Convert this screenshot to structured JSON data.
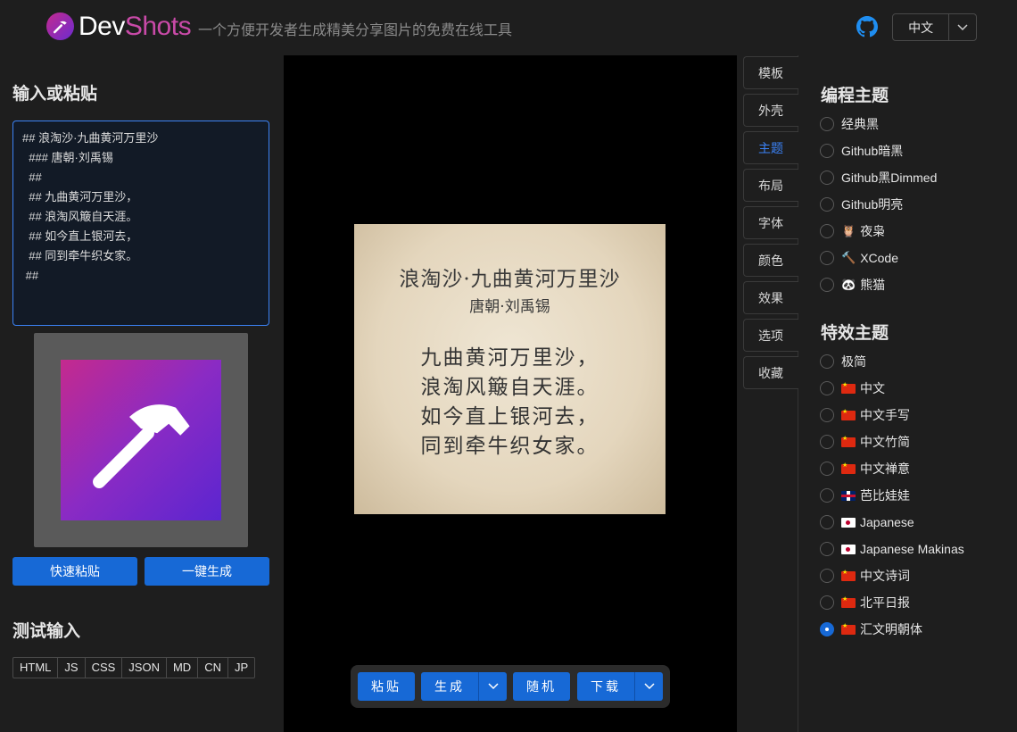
{
  "header": {
    "brand_dev": "Dev",
    "brand_shots": "Shots",
    "tagline": "一个方便开发者生成精美分享图片的免费在线工具",
    "language": "中文",
    "icons": {
      "logo": "hammer-logo-icon",
      "github": "github-icon",
      "chevron": "chevron-down-icon"
    }
  },
  "left": {
    "title": "输入或粘贴",
    "editor_value": "## 浪淘沙·九曲黄河万里沙\n  ### 唐朝·刘禹锡\n  ##\n  ## 九曲黄河万里沙，\n  ## 浪淘风簸自天涯。\n  ## 如今直上银河去，\n  ## 同到牵牛织女家。\n ##",
    "paste_button": "快速粘贴",
    "generate_button": "一键生成",
    "test_title": "测试输入",
    "test_buttons": [
      "HTML",
      "JS",
      "CSS",
      "JSON",
      "MD",
      "CN",
      "JP"
    ]
  },
  "canvas": {
    "poem": {
      "title": "浪淘沙·九曲黄河万里沙",
      "author": "唐朝·刘禹锡",
      "lines": [
        "九曲黄河万里沙，",
        "浪淘风簸自天涯。",
        "如今直上银河去，",
        "同到牵牛织女家。"
      ]
    },
    "toolbar": {
      "paste": "粘贴",
      "generate": "生成",
      "random": "随机",
      "download": "下载"
    }
  },
  "right": {
    "tabs": [
      "模板",
      "外壳",
      "主题",
      "布局",
      "字体",
      "颜色",
      "效果",
      "选项",
      "收藏"
    ],
    "active_tab": "主题",
    "code_themes_title": "编程主题",
    "code_themes": [
      {
        "label": "经典黑",
        "icon": ""
      },
      {
        "label": "Github暗黑",
        "icon": ""
      },
      {
        "label": "Github黑Dimmed",
        "icon": ""
      },
      {
        "label": "Github明亮",
        "icon": ""
      },
      {
        "label": "夜枭",
        "icon": "owl-icon"
      },
      {
        "label": "XCode",
        "icon": "hammer-icon"
      },
      {
        "label": "熊猫",
        "icon": "panda-icon"
      }
    ],
    "effect_themes_title": "特效主题",
    "effect_themes": [
      {
        "label": "极简",
        "icon": ""
      },
      {
        "label": "中文",
        "icon": "flag-cn"
      },
      {
        "label": "中文手写",
        "icon": "flag-cn"
      },
      {
        "label": "中文竹简",
        "icon": "flag-cn"
      },
      {
        "label": "中文禅意",
        "icon": "flag-cn"
      },
      {
        "label": "芭比娃娃",
        "icon": "flag-uk"
      },
      {
        "label": "Japanese",
        "icon": "flag-jp"
      },
      {
        "label": "Japanese Makinas",
        "icon": "flag-jp"
      },
      {
        "label": "中文诗词",
        "icon": "flag-cn"
      },
      {
        "label": "北平日报",
        "icon": "flag-cn"
      },
      {
        "label": "汇文明朝体",
        "icon": "flag-cn"
      }
    ],
    "selected_effect": "汇文明朝体",
    "colors": {
      "accent": "#1769d6",
      "active_tab": "#3b82f6",
      "brand_pink": "#c94aa8"
    }
  }
}
